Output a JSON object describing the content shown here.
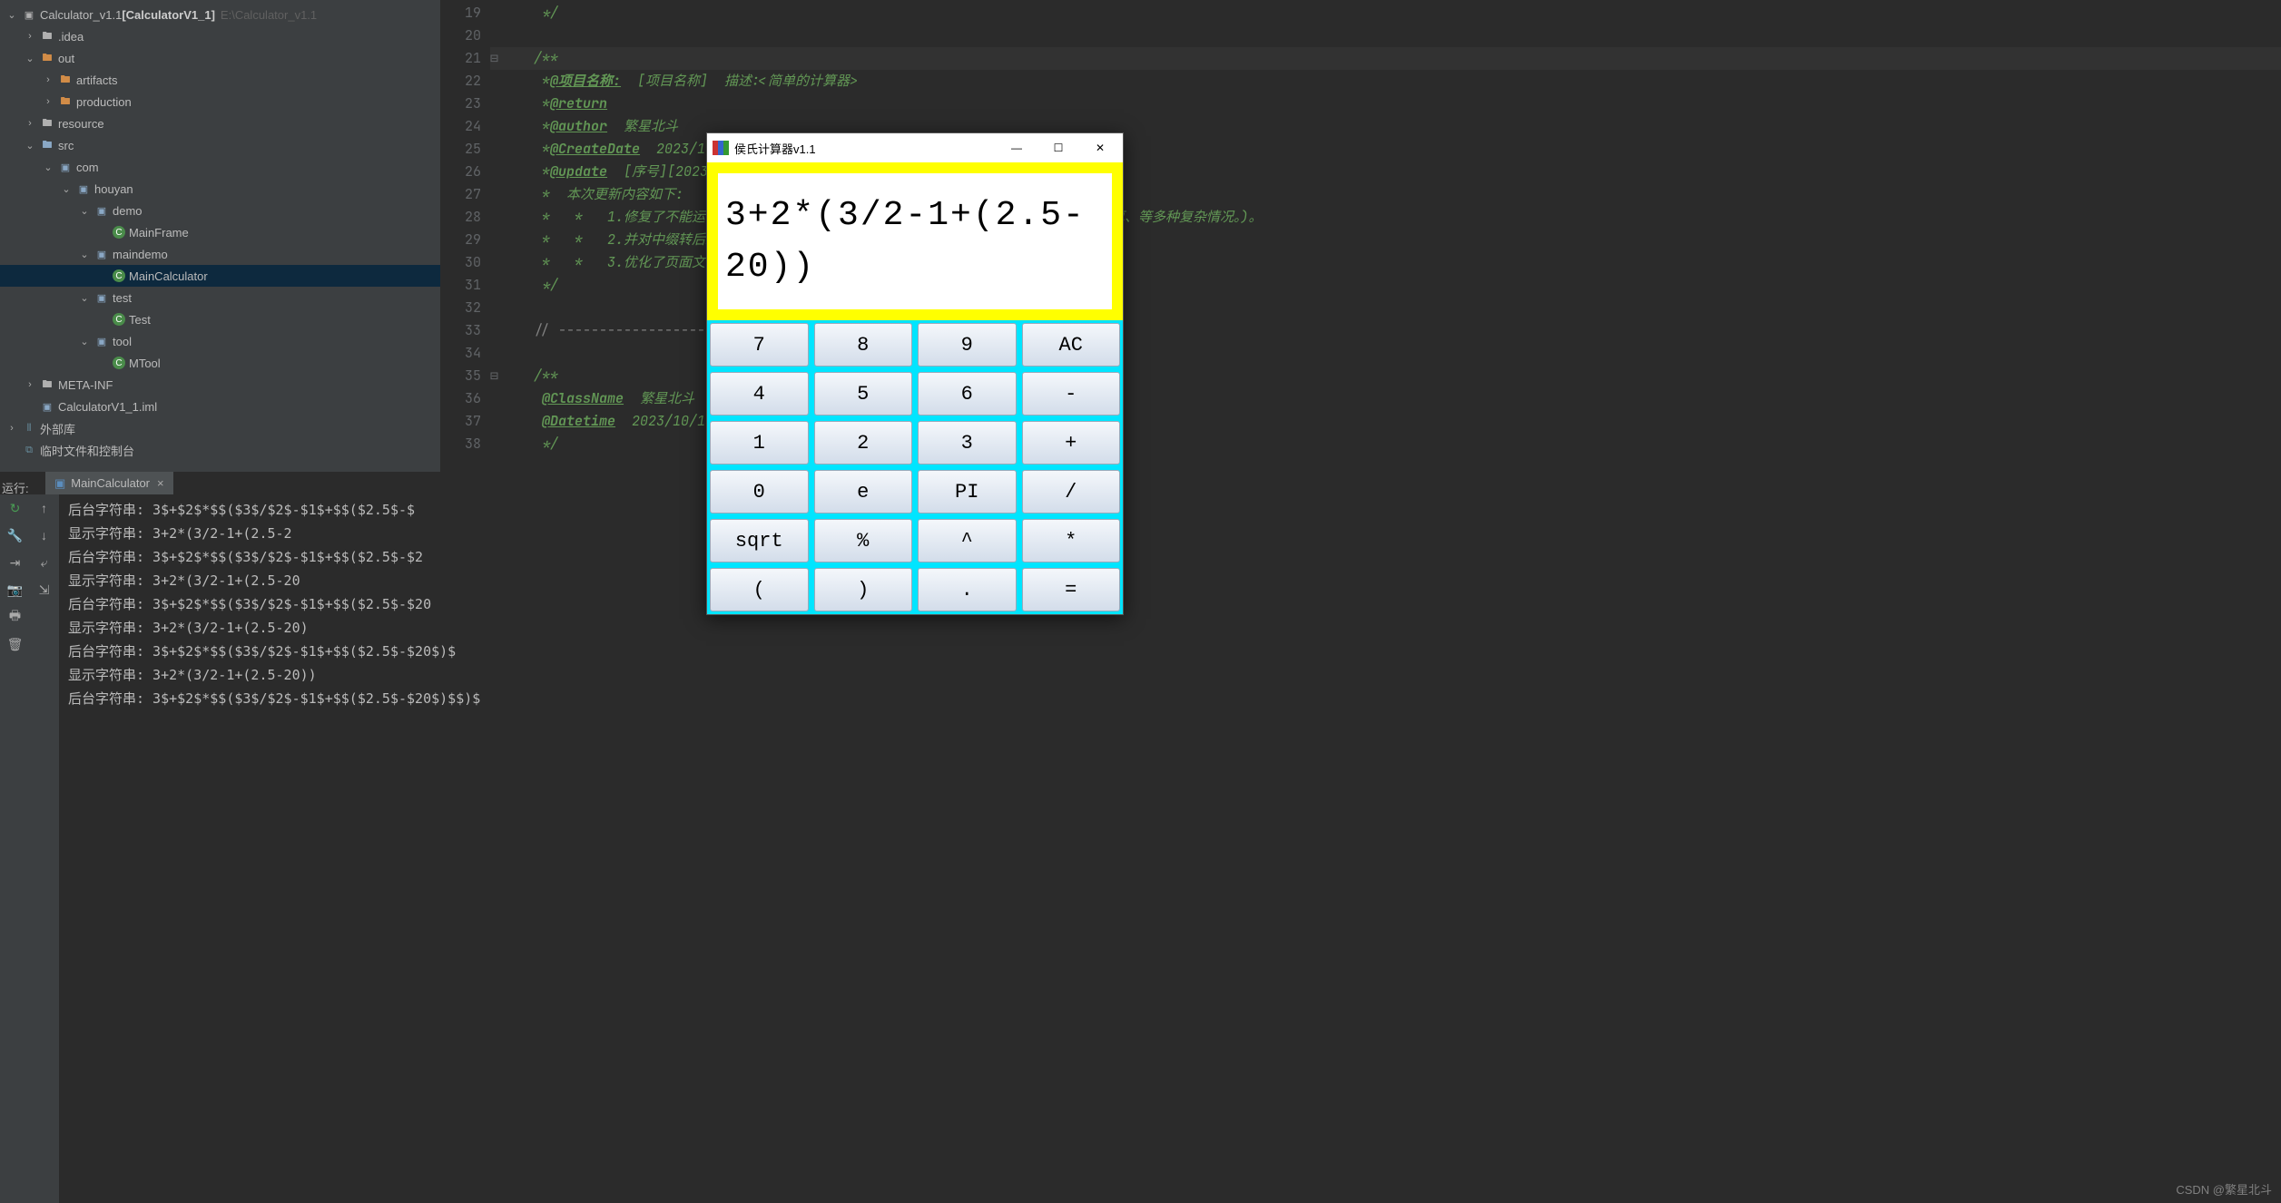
{
  "project": {
    "root": "Calculator_v1.1",
    "module": "[CalculatorV1_1]",
    "path": "E:\\Calculator_v1.1",
    "nodes": [
      {
        "indent": 0,
        "arrow": "open",
        "icon": "folder-root",
        "label": "Calculator_v1.1",
        "extra_module": "[CalculatorV1_1]",
        "extra_path": "E:\\Calculator_v1.1"
      },
      {
        "indent": 1,
        "arrow": "closed",
        "icon": "folder",
        "label": ".idea"
      },
      {
        "indent": 1,
        "arrow": "open",
        "icon": "folder-open",
        "label": "out"
      },
      {
        "indent": 2,
        "arrow": "closed",
        "icon": "folder-open",
        "label": "artifacts"
      },
      {
        "indent": 2,
        "arrow": "closed",
        "icon": "folder-open",
        "label": "production"
      },
      {
        "indent": 1,
        "arrow": "closed",
        "icon": "folder",
        "label": "resource"
      },
      {
        "indent": 1,
        "arrow": "open",
        "icon": "folder-src",
        "label": "src"
      },
      {
        "indent": 2,
        "arrow": "open",
        "icon": "pkg",
        "label": "com"
      },
      {
        "indent": 3,
        "arrow": "open",
        "icon": "pkg",
        "label": "houyan"
      },
      {
        "indent": 4,
        "arrow": "open",
        "icon": "pkg",
        "label": "demo"
      },
      {
        "indent": 5,
        "arrow": "",
        "icon": "class",
        "label": "MainFrame"
      },
      {
        "indent": 4,
        "arrow": "open",
        "icon": "pkg",
        "label": "maindemo"
      },
      {
        "indent": 5,
        "arrow": "",
        "icon": "class",
        "label": "MainCalculator",
        "selected": true
      },
      {
        "indent": 4,
        "arrow": "open",
        "icon": "pkg",
        "label": "test"
      },
      {
        "indent": 5,
        "arrow": "",
        "icon": "class",
        "label": "Test"
      },
      {
        "indent": 4,
        "arrow": "open",
        "icon": "pkg",
        "label": "tool"
      },
      {
        "indent": 5,
        "arrow": "",
        "icon": "class",
        "label": "MTool"
      },
      {
        "indent": 1,
        "arrow": "closed",
        "icon": "folder",
        "label": "META-INF"
      },
      {
        "indent": 1,
        "arrow": "",
        "icon": "iml",
        "label": "CalculatorV1_1.iml"
      },
      {
        "indent": 0,
        "arrow": "closed",
        "icon": "lib",
        "label": "外部库"
      },
      {
        "indent": 0,
        "arrow": "",
        "icon": "scratch",
        "label": "临时文件和控制台"
      }
    ]
  },
  "editor": {
    "first_line_no": 19,
    "lines": [
      {
        "n": 19,
        "cls": "doc",
        "t": " */"
      },
      {
        "n": 20,
        "cls": "",
        "t": ""
      },
      {
        "n": 21,
        "cls": "doc",
        "t": "/**",
        "fold": true,
        "hl": true
      },
      {
        "n": 22,
        "cls": "doc",
        "t": " *@项目名称:  [项目名称]  描述:<简单的计算器>",
        "tag": "@项目名称:"
      },
      {
        "n": 23,
        "cls": "doc",
        "t": " *@return",
        "tag": "@return"
      },
      {
        "n": 24,
        "cls": "doc",
        "t": " *@author  繁星北斗",
        "tag": "@author"
      },
      {
        "n": 25,
        "cls": "doc",
        "t": " *@CreateDate  2023/10/",
        "tag": "@CreateDate"
      },
      {
        "n": 26,
        "cls": "doc",
        "t": " *@update  [序号][2023/1",
        "tag": "@update"
      },
      {
        "n": 27,
        "cls": "doc",
        "t": " *  本次更新内容如下:"
      },
      {
        "n": 28,
        "cls": "doc",
        "t": " *   *   1.修复了不能运算负                                           再运算、等多种复杂情况。)。"
      },
      {
        "n": 29,
        "cls": "doc",
        "t": " *   *   2.并对中缀转后缀表"
      },
      {
        "n": 30,
        "cls": "doc",
        "t": " *   *   3.优化了页面文本框"
      },
      {
        "n": 31,
        "cls": "doc",
        "t": " */"
      },
      {
        "n": 32,
        "cls": "",
        "t": ""
      },
      {
        "n": 33,
        "cls": "cmt",
        "t": "// -----------------------"
      },
      {
        "n": 34,
        "cls": "",
        "t": ""
      },
      {
        "n": 35,
        "cls": "doc",
        "t": "/**",
        "fold": true
      },
      {
        "n": 36,
        "cls": "doc",
        "t": " @ClassName  繁星北斗",
        "tag": "@ClassName"
      },
      {
        "n": 37,
        "cls": "doc",
        "t": " @Datetime  2023/10/14",
        "tag": "@Datetime"
      },
      {
        "n": 38,
        "cls": "doc",
        "t": " */"
      }
    ]
  },
  "run": {
    "label": "运行:",
    "tab": "MainCalculator",
    "output": [
      "后台字符串: 3$+$2$*$$($3$/$2$-$1$+$$($2.5$-$",
      "显示字符串: 3+2*(3/2-1+(2.5-2",
      "后台字符串: 3$+$2$*$$($3$/$2$-$1$+$$($2.5$-$2",
      "显示字符串: 3+2*(3/2-1+(2.5-20",
      "后台字符串: 3$+$2$*$$($3$/$2$-$1$+$$($2.5$-$20",
      "显示字符串: 3+2*(3/2-1+(2.5-20)",
      "后台字符串: 3$+$2$*$$($3$/$2$-$1$+$$($2.5$-$20$)$",
      "显示字符串: 3+2*(3/2-1+(2.5-20))",
      "后台字符串: 3$+$2$*$$($3$/$2$-$1$+$$($2.5$-$20$)$$)$"
    ]
  },
  "calc": {
    "title": "侯氏计算器v1.1",
    "display": "3+2*(3/2-1+(2.5-20))",
    "keys": [
      [
        "7",
        "8",
        "9",
        "AC"
      ],
      [
        "4",
        "5",
        "6",
        "-"
      ],
      [
        "1",
        "2",
        "3",
        "+"
      ],
      [
        "0",
        "e",
        "PI",
        "/"
      ],
      [
        "sqrt",
        "%",
        "^",
        "*"
      ],
      [
        "(",
        ")",
        ".",
        "="
      ]
    ]
  },
  "watermark": "CSDN @繁星北斗"
}
